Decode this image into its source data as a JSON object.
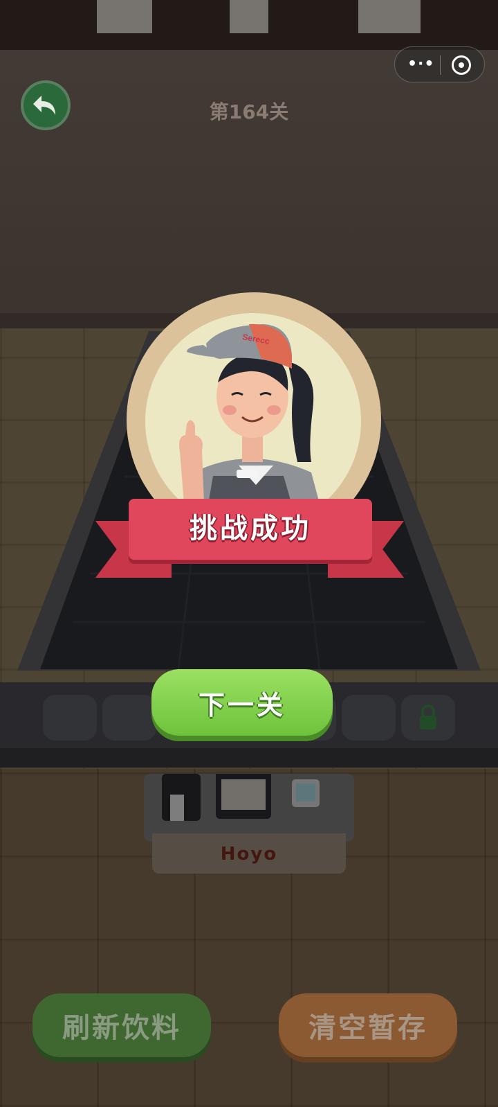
{
  "level": {
    "label": "第164关"
  },
  "popup": {
    "banner_text": "挑战成功",
    "cap_text": "Serecc",
    "next_button": "下一关"
  },
  "counter": {
    "logo": "Hoyo"
  },
  "bottom": {
    "refresh_label": "刷新饮料",
    "clear_label": "清空暂存"
  },
  "colors": {
    "next_green": "#7ed048",
    "banner_red": "#e1475c",
    "refresh_green": "#3f6830",
    "clear_orange": "#8b5a33"
  }
}
